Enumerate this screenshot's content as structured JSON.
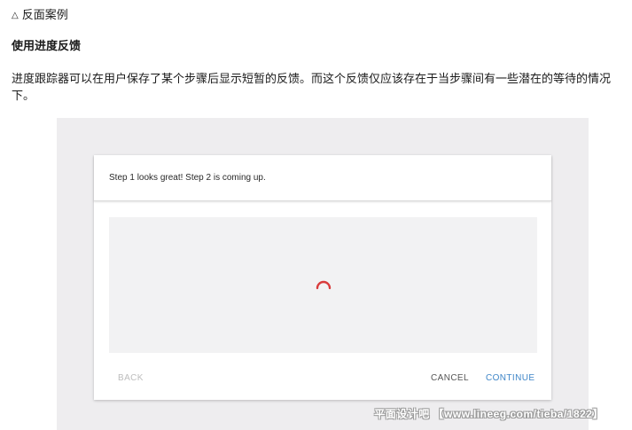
{
  "doc": {
    "header_icon": "triangle-outline-icon",
    "header_label": "反面案例",
    "section_title": "使用进度反馈",
    "body_text": "进度跟踪器可以在用户保存了某个步骤后显示短暂的反馈。而这个反馈仅应该存在于当步骤间有一些潜在的等待的情况下。"
  },
  "figure": {
    "banner_text": "Step 1 looks great! Step 2 is coming up.",
    "spinner_icon": "loading-spinner-icon",
    "spinner_color": "#d93b3b",
    "accent_color": "#3f86c8",
    "actions": {
      "back_label": "BACK",
      "cancel_label": "CANCEL",
      "continue_label": "CONTINUE"
    }
  },
  "watermark": {
    "text": "平面设计吧 【www.lineeg.com/tieba/1822】"
  }
}
